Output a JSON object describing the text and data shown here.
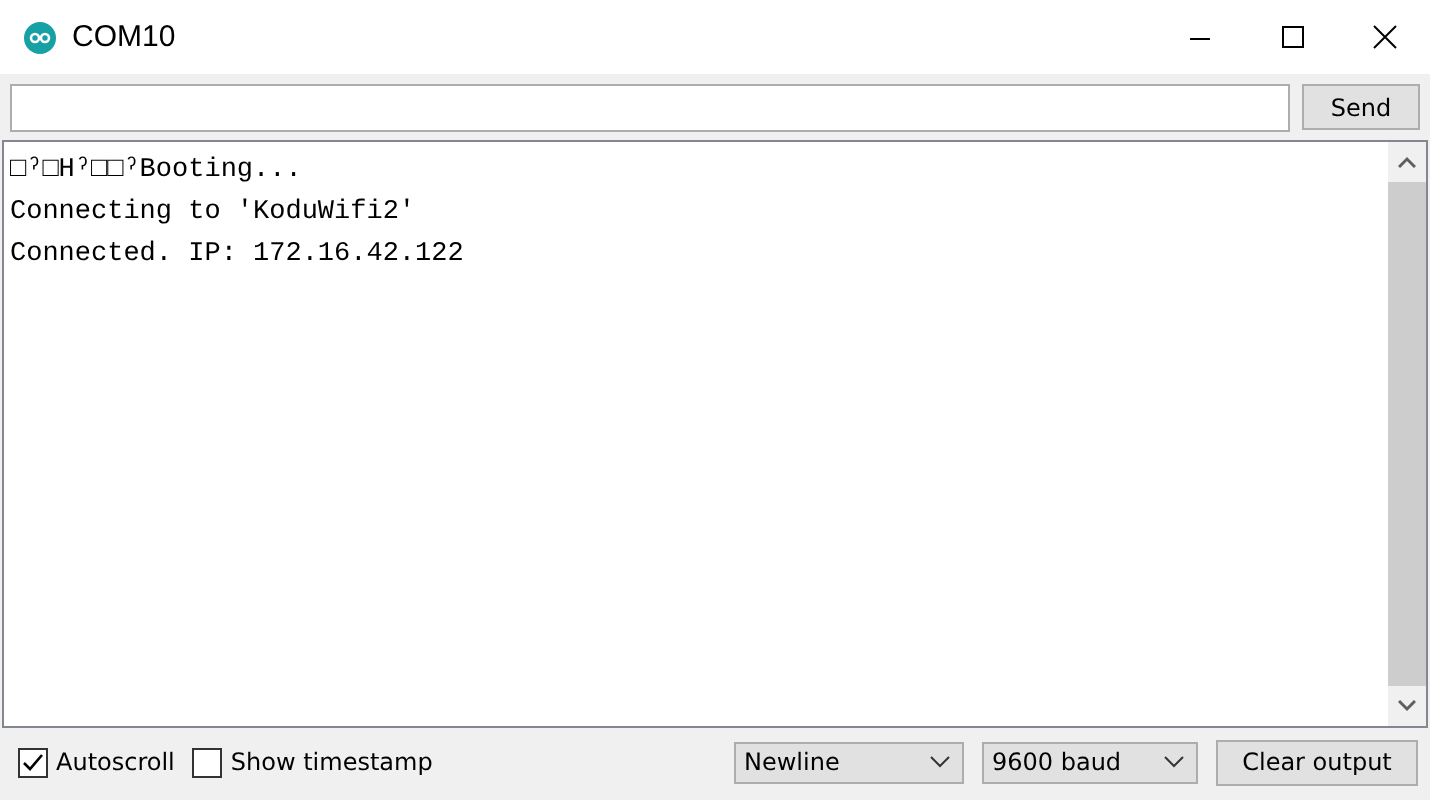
{
  "window": {
    "title": "COM10"
  },
  "send_bar": {
    "button": "Send"
  },
  "output": {
    "lines": [
      "□ˀ□Hˀ□□ˀBooting...",
      "Connecting to 'KoduWifi2'",
      "Connected. IP: 172.16.42.122"
    ]
  },
  "footer": {
    "checkboxes": [
      {
        "label": "Autoscroll",
        "checked": true
      },
      {
        "label": "Show timestamp",
        "checked": false
      }
    ],
    "dropdowns": [
      {
        "value": "Newline"
      },
      {
        "value": "9600 baud"
      }
    ],
    "button": "Clear output"
  }
}
